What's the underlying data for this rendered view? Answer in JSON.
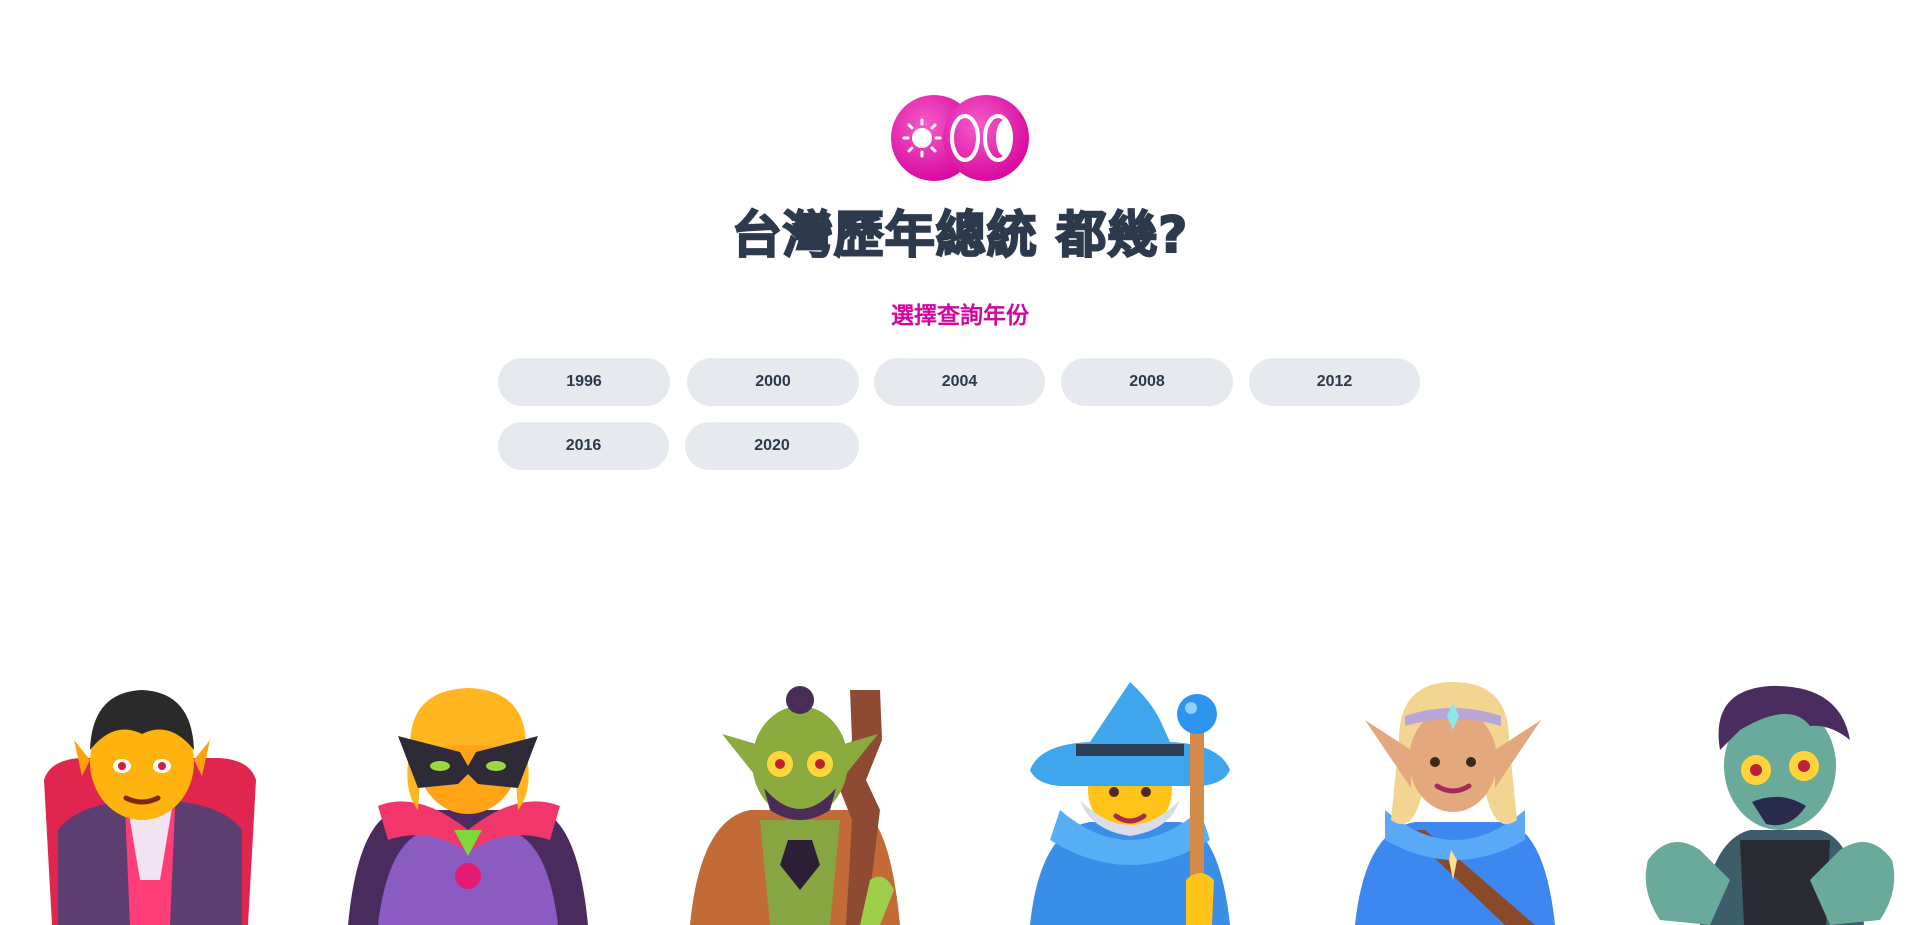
{
  "header": {
    "logo_icon": "sun-moon-logo-icon",
    "title": "台灣歷年總統 都幾?",
    "subtitle": "選擇查詢年份"
  },
  "years": [
    "1996",
    "2000",
    "2004",
    "2008",
    "2012",
    "2016",
    "2020"
  ],
  "characters": [
    {
      "icon": "vampire-icon"
    },
    {
      "icon": "supervillain-icon"
    },
    {
      "icon": "troll-icon"
    },
    {
      "icon": "mage-icon"
    },
    {
      "icon": "elf-icon"
    },
    {
      "icon": "zombie-icon"
    }
  ],
  "colors": {
    "title": "#2d3a4d",
    "subtitle": "#d1089e",
    "button_bg": "#e6e9ed",
    "logo": "#e10ea8"
  }
}
